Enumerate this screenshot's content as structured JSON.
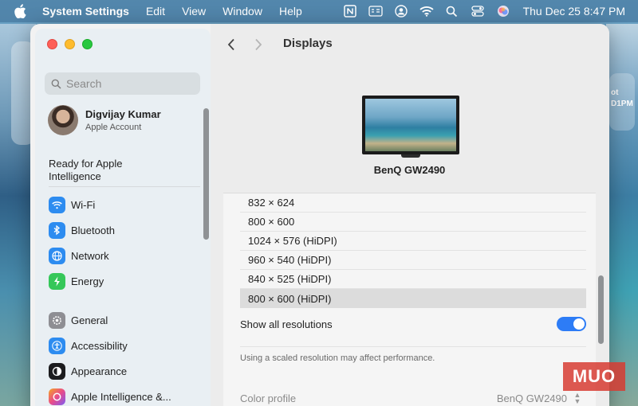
{
  "menubar": {
    "app_name": "System Settings",
    "menus": [
      "Edit",
      "View",
      "Window",
      "Help"
    ],
    "clock": "Thu Dec 25  8:47 PM"
  },
  "wallpaper": {
    "right_widget_text": "ot\nD1PM"
  },
  "sidebar": {
    "search_placeholder": "Search",
    "account": {
      "name": "Digvijay Kumar",
      "subtitle": "Apple Account"
    },
    "ready_text": "Ready for Apple Intelligence",
    "group1": [
      {
        "label": "Wi-Fi",
        "icon": "wifi-icon",
        "color": "#2d8cf0"
      },
      {
        "label": "Bluetooth",
        "icon": "bluetooth-icon",
        "color": "#2d8cf0"
      },
      {
        "label": "Network",
        "icon": "globe-icon",
        "color": "#2d8cf0"
      },
      {
        "label": "Energy",
        "icon": "battery-icon",
        "color": "#35c759"
      }
    ],
    "group2": [
      {
        "label": "General",
        "icon": "gear-icon",
        "color": "#8e8e93"
      },
      {
        "label": "Accessibility",
        "icon": "accessibility-icon",
        "color": "#2d8cf0"
      },
      {
        "label": "Appearance",
        "icon": "appearance-icon",
        "color": "#1c1c1e"
      },
      {
        "label": "Apple Intelligence &...",
        "icon": "apple-intelligence-icon",
        "color": "#f07a3a"
      }
    ]
  },
  "content": {
    "title": "Displays",
    "display_name": "BenQ GW2490",
    "resolutions": [
      {
        "label": "832 × 624",
        "selected": false
      },
      {
        "label": "800 × 600",
        "selected": false
      },
      {
        "label": "1024 × 576 (HiDPI)",
        "selected": false
      },
      {
        "label": "960 × 540 (HiDPI)",
        "selected": false
      },
      {
        "label": "840 × 525 (HiDPI)",
        "selected": false
      },
      {
        "label": "800 × 600 (HiDPI)",
        "selected": true
      }
    ],
    "show_all_label": "Show all resolutions",
    "show_all_on": true,
    "hint": "Using a scaled resolution may affect performance.",
    "color_profile_label": "Color profile",
    "color_profile_value": "BenQ GW2490"
  },
  "watermark": "MUO",
  "colors": {
    "accent": "#2d7cf6",
    "selected_row": "#dcdcdc"
  }
}
